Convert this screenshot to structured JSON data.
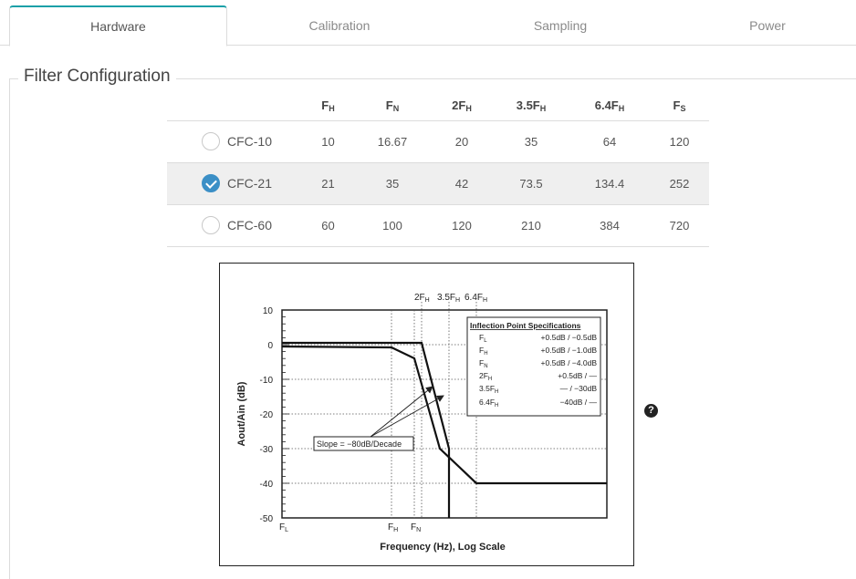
{
  "tabs": [
    {
      "label": "Hardware",
      "active": true
    },
    {
      "label": "Calibration",
      "active": false
    },
    {
      "label": "Sampling",
      "active": false
    },
    {
      "label": "Power",
      "active": false
    }
  ],
  "section": {
    "title": "Filter Configuration"
  },
  "table": {
    "headers": [
      {
        "main": "F",
        "sub": "H"
      },
      {
        "main": "F",
        "sub": "N"
      },
      {
        "main": "2F",
        "sub": "H"
      },
      {
        "main": "3.5F",
        "sub": "H"
      },
      {
        "main": "6.4F",
        "sub": "H"
      },
      {
        "main": "F",
        "sub": "S"
      }
    ],
    "rows": [
      {
        "name": "CFC-10",
        "selected": false,
        "values": [
          "10",
          "16.67",
          "20",
          "35",
          "64",
          "120"
        ]
      },
      {
        "name": "CFC-21",
        "selected": true,
        "values": [
          "21",
          "35",
          "42",
          "73.5",
          "134.4",
          "252"
        ]
      },
      {
        "name": "CFC-60",
        "selected": false,
        "values": [
          "60",
          "100",
          "120",
          "210",
          "384",
          "720"
        ]
      }
    ]
  },
  "figure": {
    "ylabel": "Aout/Ain (dB)",
    "xlabel": "Frequency (Hz), Log Scale",
    "yticks": [
      "10",
      "0",
      "-10",
      "-20",
      "-30",
      "-40",
      "-50"
    ],
    "xticks_bottom": [
      {
        "main": "F",
        "sub": "L"
      },
      {
        "main": "F",
        "sub": "H"
      },
      {
        "main": "F",
        "sub": "N"
      }
    ],
    "xticks_top": [
      {
        "main": "2F",
        "sub": "H"
      },
      {
        "main": "3.5F",
        "sub": "H"
      },
      {
        "main": "6.4F",
        "sub": "H"
      }
    ],
    "slope_label": "Slope = −80dB/Decade",
    "spec_title": "Inflection Point Specifications",
    "specs": [
      {
        "main": "F",
        "sub": "L",
        "value": "+0.5dB / −0.5dB"
      },
      {
        "main": "F",
        "sub": "H",
        "value": "+0.5dB / −1.0dB"
      },
      {
        "main": "F",
        "sub": "N",
        "value": "+0.5dB / −4.0dB"
      },
      {
        "main": "2F",
        "sub": "H",
        "value": "+0.5dB /  —"
      },
      {
        "main": "3.5F",
        "sub": "H",
        "value": "—     / −30dB"
      },
      {
        "main": "6.4F",
        "sub": "H",
        "value": "−40dB /  —"
      }
    ]
  },
  "help": {
    "glyph": "?"
  }
}
